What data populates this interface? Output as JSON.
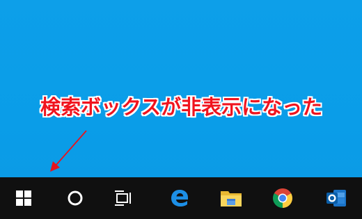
{
  "annotation": {
    "text": "検索ボックスが非表示になった",
    "color": "#f0141e"
  },
  "taskbar": {
    "background": "#101010",
    "items": [
      {
        "icon": "windows-start-icon"
      },
      {
        "icon": "cortana-circle-icon"
      },
      {
        "icon": "task-view-icon"
      },
      {
        "icon": "edge-browser-icon"
      },
      {
        "icon": "file-explorer-icon"
      },
      {
        "icon": "chrome-browser-icon"
      },
      {
        "icon": "outlook-icon"
      }
    ]
  },
  "desktop": {
    "background": "#0b9de8"
  }
}
